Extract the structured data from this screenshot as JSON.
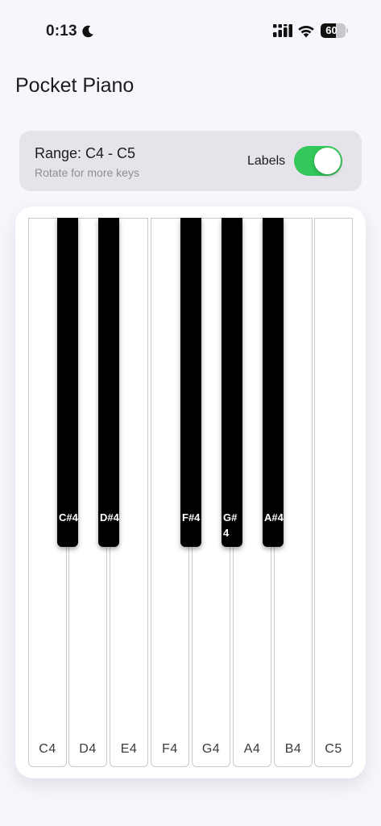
{
  "status_bar": {
    "time": "0:13",
    "moon_icon": "moon-icon",
    "signal_icon": "cellular-signal-icon",
    "wifi_icon": "wifi-icon",
    "battery_level": "60",
    "battery_fraction": 0.6
  },
  "app": {
    "title": "Pocket Piano"
  },
  "range_card": {
    "title": "Range: C4 - C5",
    "hint": "Rotate for more keys",
    "labels_toggle_label": "Labels",
    "labels_toggle_on": true
  },
  "piano": {
    "white_keys": [
      "C4",
      "D4",
      "E4",
      "F4",
      "G4",
      "A4",
      "B4",
      "C5"
    ],
    "black_keys": [
      "C#4",
      "D#4",
      "F#4",
      "G#4",
      "A#4"
    ]
  }
}
